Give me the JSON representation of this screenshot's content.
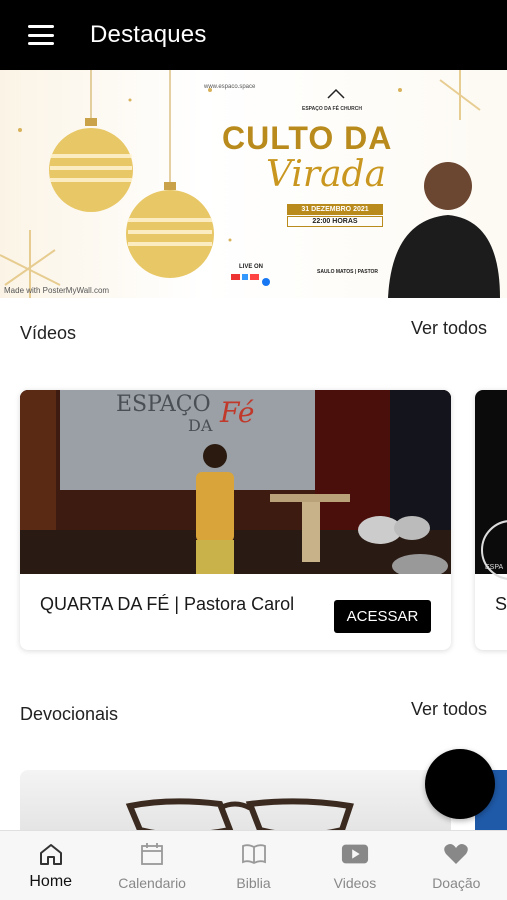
{
  "appbar": {
    "title": "Destaques"
  },
  "hero": {
    "url": "www.espaco.space",
    "church": "ESPAÇO DA FÉ CHURCH",
    "title": "CULTO DA",
    "script": "Virada",
    "date": "31 DEZEMBRO 2021",
    "time": "22:00 HORAS",
    "live": "LIVE ON",
    "pastor": "SAULO MATOS | PASTOR",
    "credit": "Made with PosterMyWall.com"
  },
  "videos": {
    "title": "Vídeos",
    "see_all": "Ver todos",
    "cards": [
      {
        "title": "QUARTA DA FÉ | Pastora Carol",
        "button": "ACESSAR",
        "thumb_sign": "ESPAÇO",
        "thumb_sign2": "DA",
        "thumb_sign3": "Fé"
      },
      {
        "title": "S",
        "thumb_text": "ESPA"
      }
    ]
  },
  "devocionais": {
    "title": "Devocionais",
    "see_all": "Ver todos"
  },
  "nav": {
    "items": [
      {
        "label": "Home",
        "icon": "home-icon",
        "active": true
      },
      {
        "label": "Calendario",
        "icon": "calendar-icon"
      },
      {
        "label": "Biblia",
        "icon": "book-icon"
      },
      {
        "label": "Videos",
        "icon": "youtube-icon"
      },
      {
        "label": "Doação",
        "icon": "heart-icon"
      }
    ]
  },
  "colors": {
    "accent": "#000000",
    "gold": "#b98a1c",
    "nav_inactive": "#888888"
  }
}
